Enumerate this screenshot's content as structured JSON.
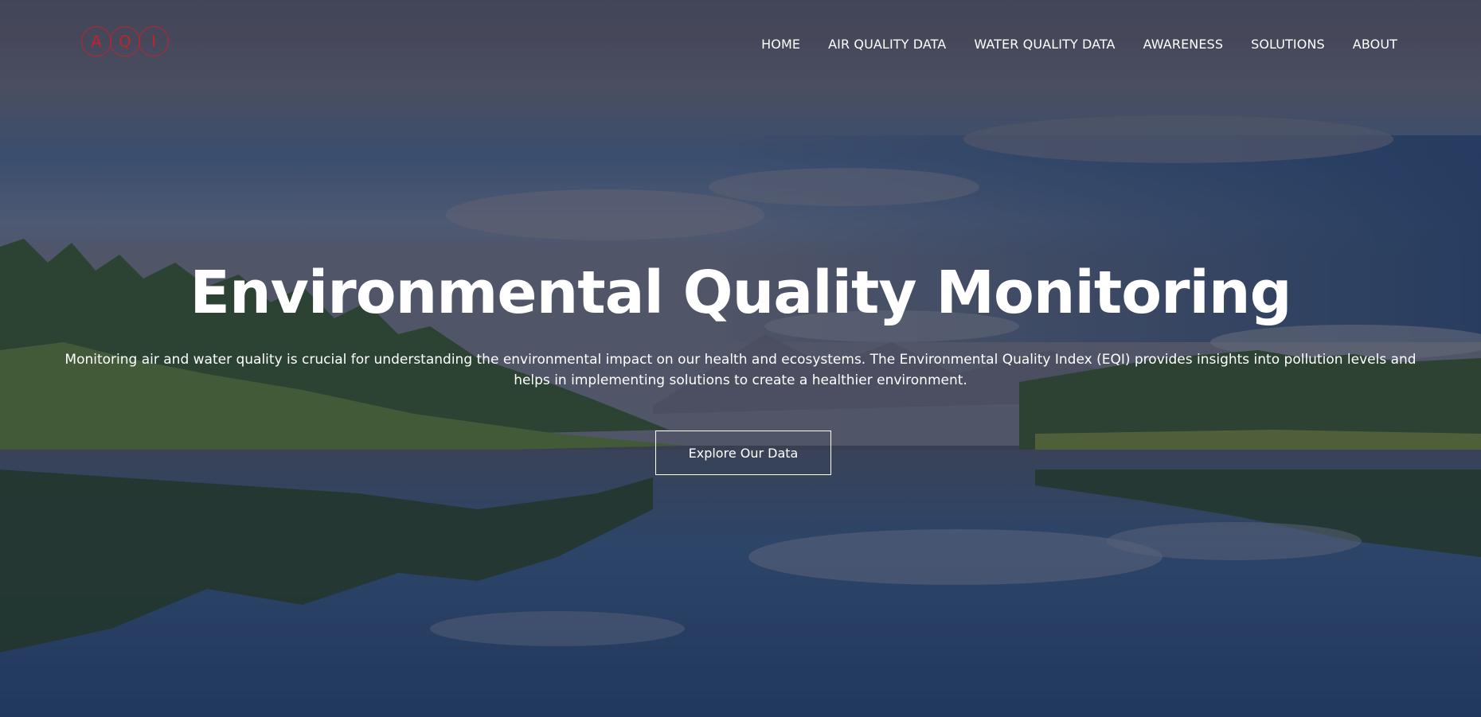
{
  "logo": {
    "letters": [
      "A",
      "Q",
      "I"
    ],
    "color": "#c0222e"
  },
  "nav": {
    "items": [
      {
        "label": "HOME"
      },
      {
        "label": "AIR QUALITY DATA"
      },
      {
        "label": "WATER QUALITY DATA"
      },
      {
        "label": "AWARENESS"
      },
      {
        "label": "SOLUTIONS"
      },
      {
        "label": "ABOUT"
      }
    ]
  },
  "hero": {
    "title": "Environmental Quality Monitoring",
    "description": "Monitoring air and water quality is crucial for understanding the environmental impact on our health and ecosystems. The Environmental Quality Index (EQI) provides insights into pollution levels and helps in implementing solutions to create a healthier environment.",
    "cta_label": "Explore Our Data",
    "background": "lake-landscape-image"
  }
}
